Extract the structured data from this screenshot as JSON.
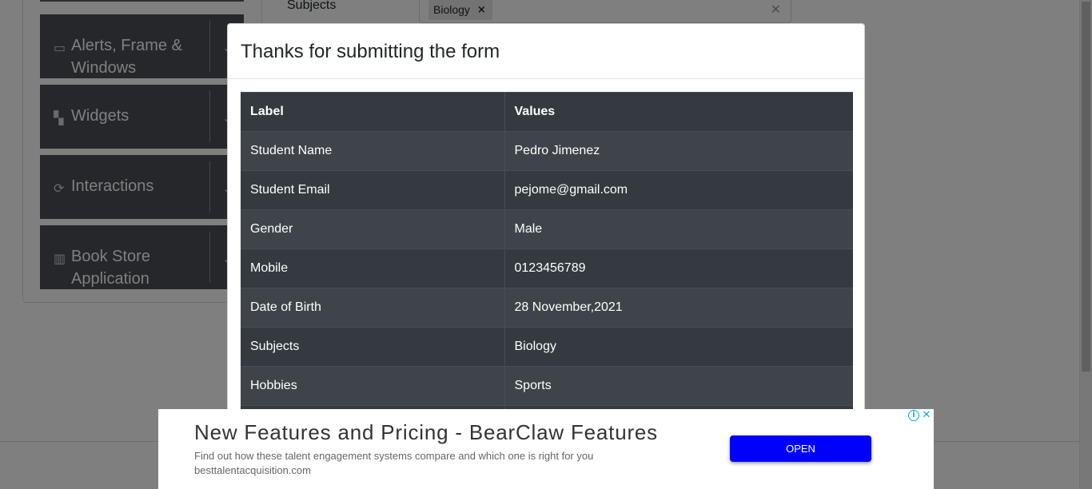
{
  "sidebar": {
    "groups": [
      {
        "label_line1": "Alerts, Frame &",
        "label_line2": "Windows",
        "icon": "window-icon"
      },
      {
        "label_line1": "Widgets",
        "label_line2": "",
        "icon": "widgets-icon"
      },
      {
        "label_line1": "Interactions",
        "label_line2": "",
        "icon": "interactions-icon"
      },
      {
        "label_line1": "Book Store",
        "label_line2": "Application",
        "icon": "book-icon"
      }
    ]
  },
  "form": {
    "subjects_label": "Subjects",
    "subject_chip": "Biology"
  },
  "modal": {
    "title": "Thanks for submitting the form",
    "header_label": "Label",
    "header_value": "Values",
    "rows": [
      {
        "label": "Student Name",
        "value": "Pedro Jimenez"
      },
      {
        "label": "Student Email",
        "value": "pejome@gmail.com"
      },
      {
        "label": "Gender",
        "value": "Male"
      },
      {
        "label": "Mobile",
        "value": "0123456789"
      },
      {
        "label": "Date of Birth",
        "value": "28 November,2021"
      },
      {
        "label": "Subjects",
        "value": "Biology"
      },
      {
        "label": "Hobbies",
        "value": "Sports"
      }
    ]
  },
  "ad": {
    "title": "New Features and Pricing - BearClaw Features",
    "description": "Find out how these talent engagement systems compare and which one is right for you",
    "url": "besttalentacquisition.com",
    "button_label": "OPEN"
  }
}
